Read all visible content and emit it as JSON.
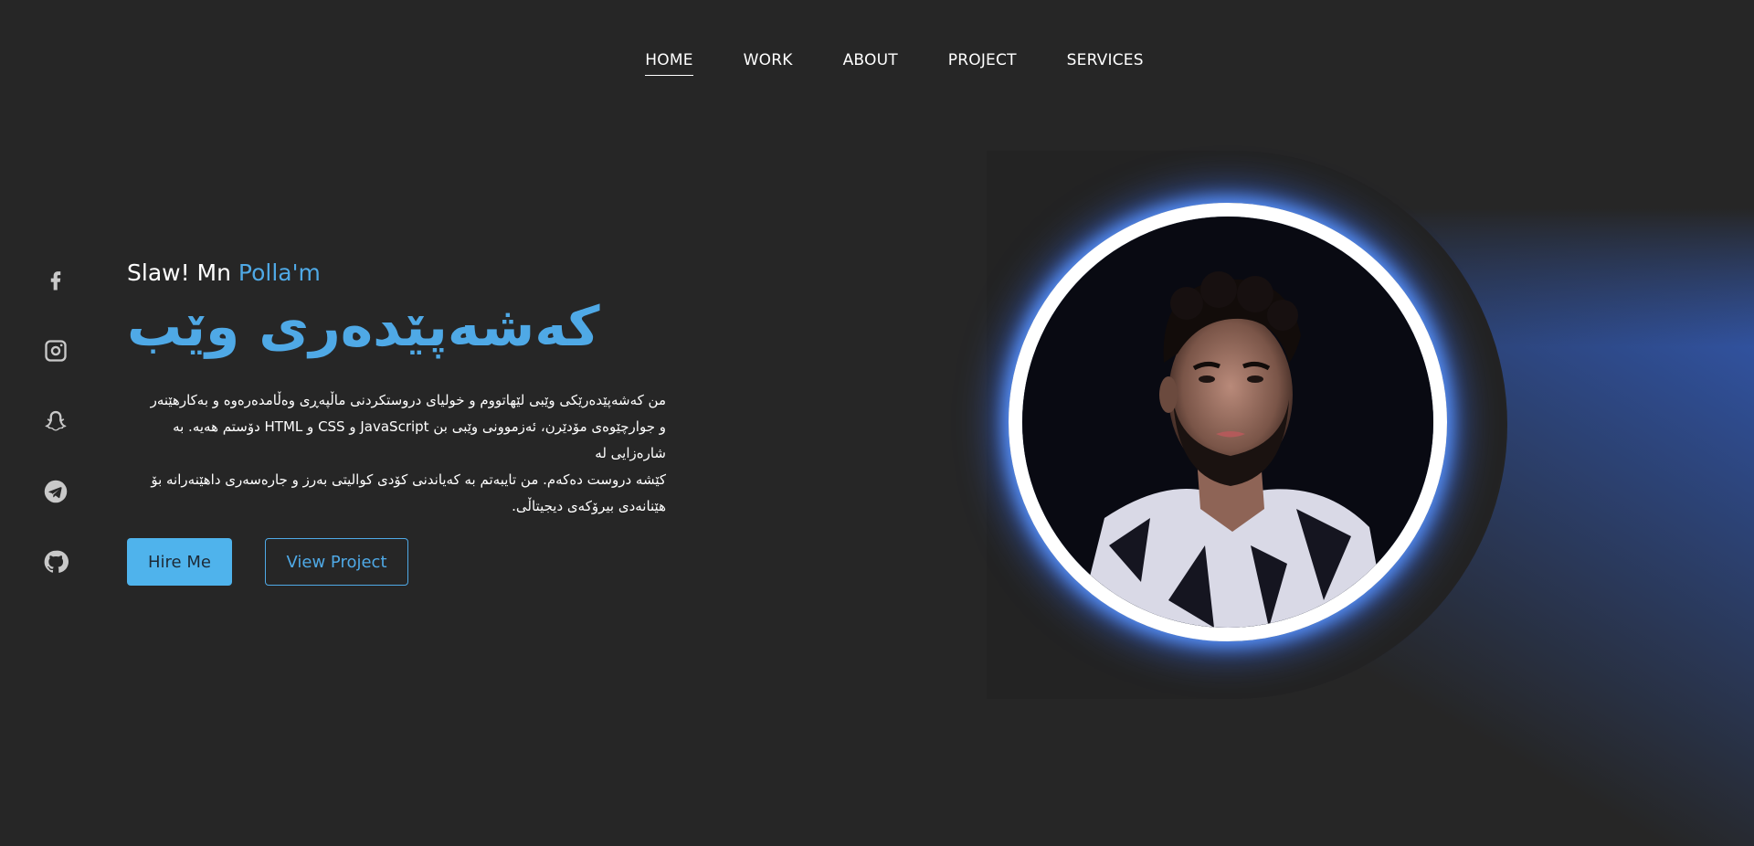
{
  "nav": {
    "items": [
      {
        "label": "HOME",
        "active": true
      },
      {
        "label": "WORK",
        "active": false
      },
      {
        "label": "ABOUT",
        "active": false
      },
      {
        "label": "PROJECT",
        "active": false
      },
      {
        "label": "SERVICES",
        "active": false
      }
    ]
  },
  "social": {
    "icons": [
      "facebook-icon",
      "instagram-icon",
      "snapchat-icon",
      "telegram-icon",
      "github-icon"
    ]
  },
  "hero": {
    "greeting_prefix": "Slaw! Mn ",
    "greeting_name": "Polla'm",
    "title": "کەشەپێدەری وێب",
    "description_lines": [
      "من کەشەپێدەرێکی وێبی لێهاتووم و خولیای دروستکردنی ماڵپەڕی وەڵامدەرەوە و بەکارهێنەر",
      "و جوارچێوەی مۆدێرن، ئەزموونی وێبی بن JavaScript و CSS و HTML دۆستم هەیە. بە شارەزایی لە",
      "کێشە دروست دەکەم. من تایبەتم بە کەیاندنی کۆدی کوالیتی بەرز و جارەسەری داهێنەرانە بۆ",
      "هێنانەدی بیرۆکەی دیجیتاڵی."
    ],
    "hire_label": "Hire Me",
    "view_label": "View Project"
  },
  "colors": {
    "accent": "#4fa9e6",
    "background": "#262626",
    "glow": "#3b6fe8"
  }
}
